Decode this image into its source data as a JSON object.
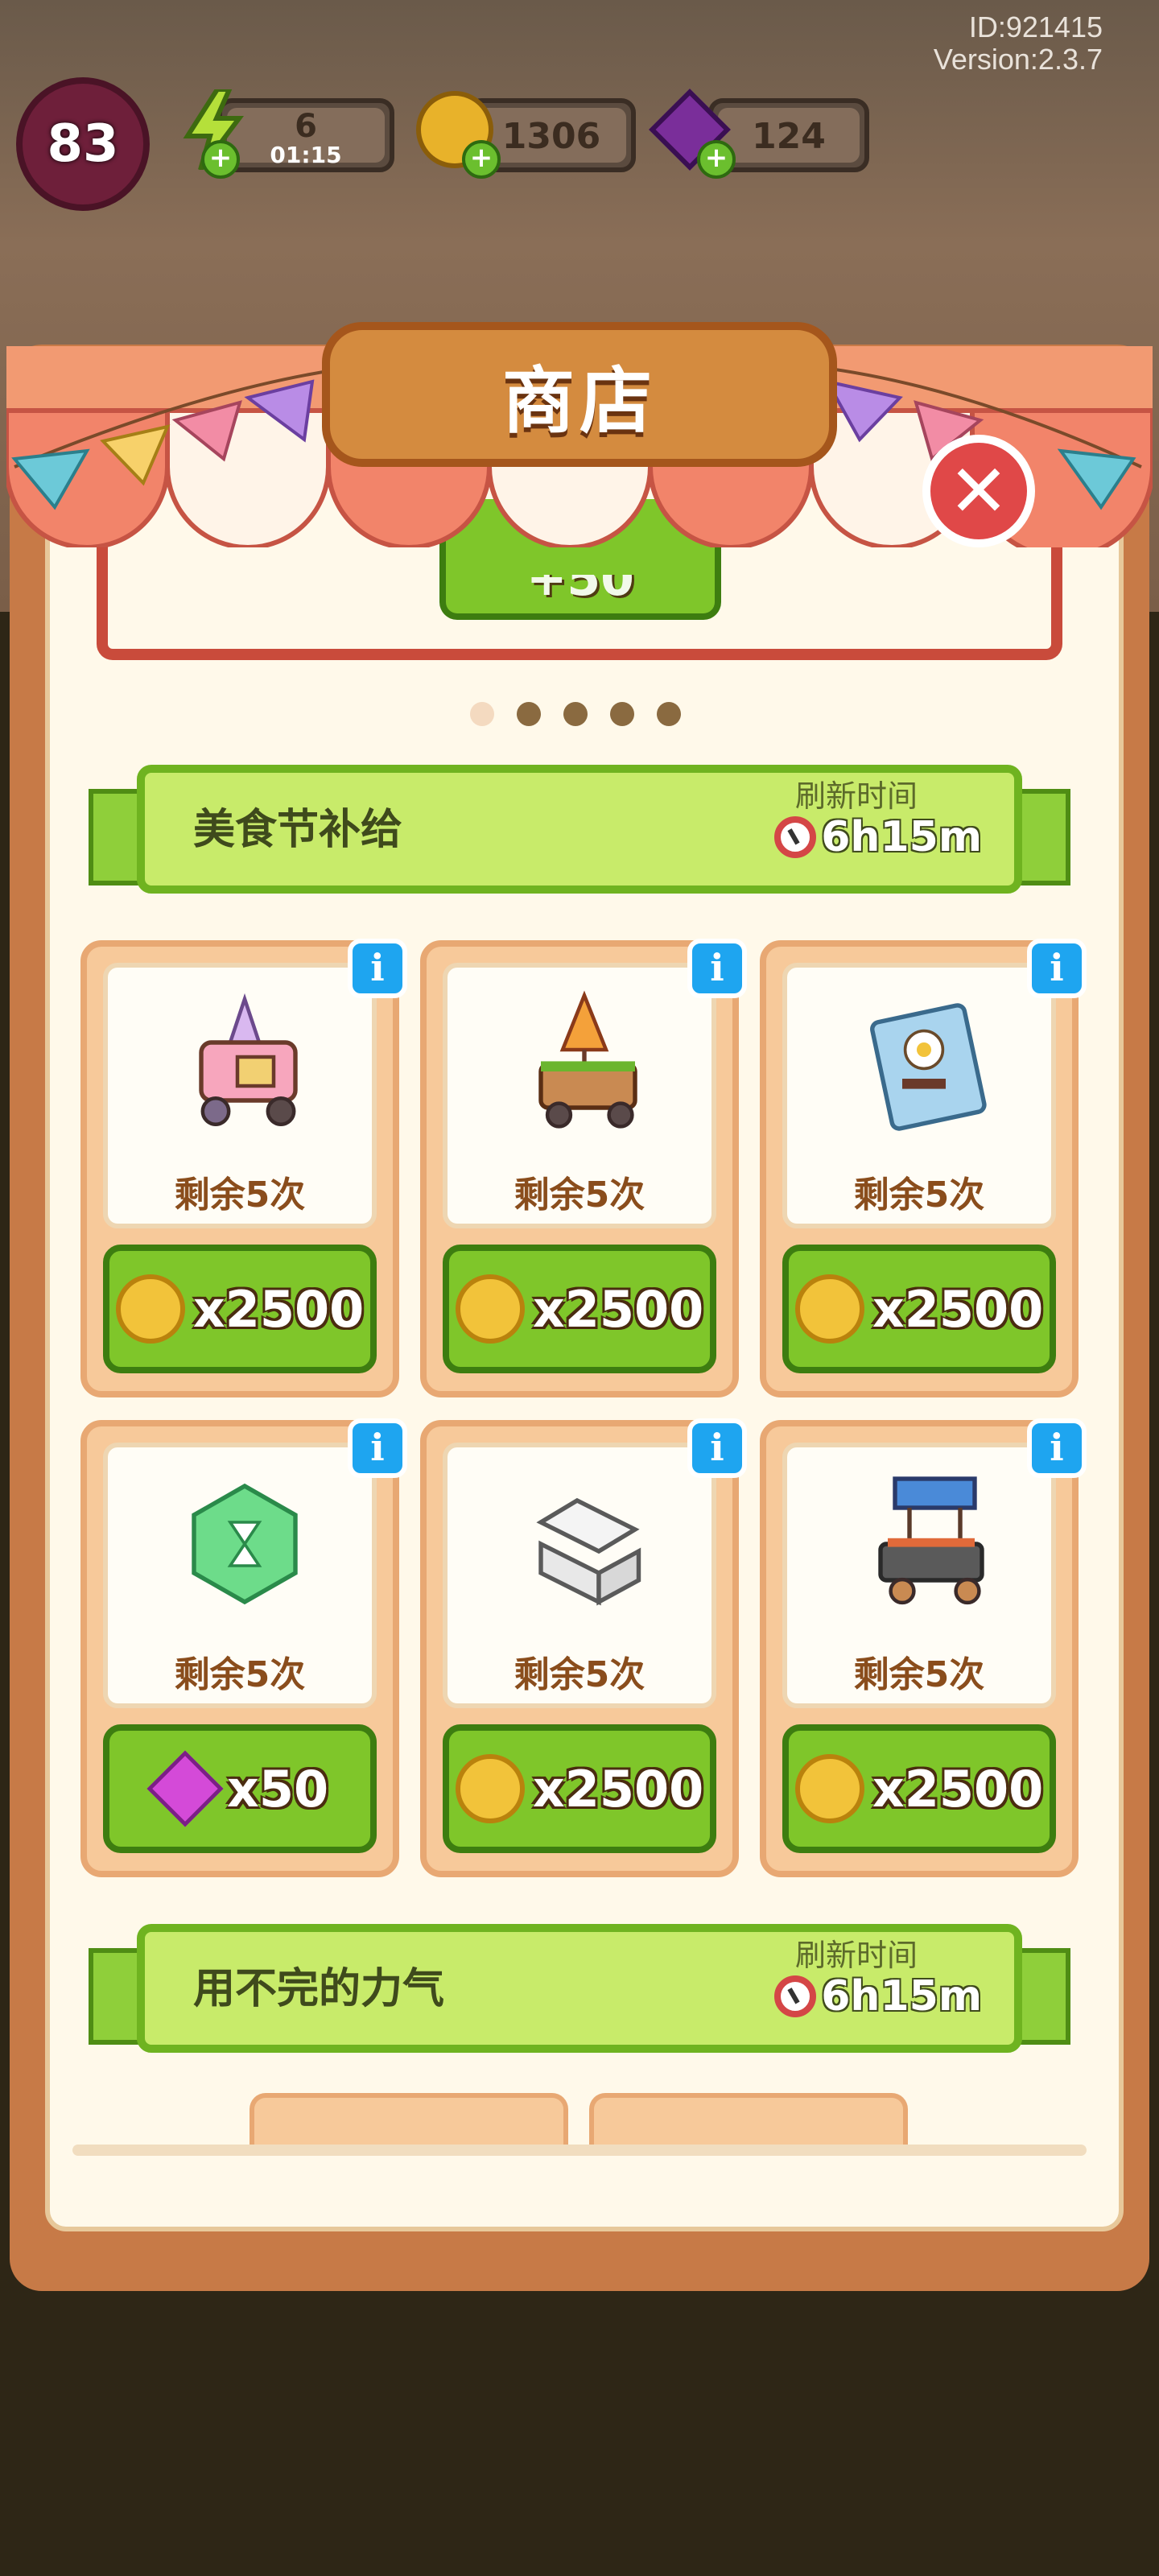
{
  "meta": {
    "id_text": "ID:921415",
    "version_text": "Version:2.3.7"
  },
  "hud": {
    "level": "83",
    "energy": {
      "value": "6",
      "timer": "01:15",
      "icon": "lightning-icon"
    },
    "coins": {
      "value": "1306",
      "icon": "coin-icon"
    },
    "gems": {
      "value": "124",
      "icon": "gem-icon"
    }
  },
  "shop": {
    "title": "商店",
    "banner_button_partial": "+50",
    "carousel": {
      "count": 5,
      "active_index": 0
    },
    "close_icon": "close-icon"
  },
  "sections": [
    {
      "title": "美食节补给",
      "refresh_label": "刷新时间",
      "refresh_time": "6h15m",
      "items": [
        {
          "art": "ice-cream-cart",
          "remaining": "剩余5次",
          "currency": "coin",
          "price": "x2500"
        },
        {
          "art": "drink-cart",
          "remaining": "剩余5次",
          "currency": "coin",
          "price": "x2500"
        },
        {
          "art": "recipe-card",
          "remaining": "剩余5次",
          "currency": "coin",
          "price": "x2500"
        },
        {
          "art": "green-hourglass-gem",
          "remaining": "剩余5次",
          "currency": "gem",
          "price": "x50"
        },
        {
          "art": "takeout-box",
          "remaining": "剩余5次",
          "currency": "coin",
          "price": "x2500"
        },
        {
          "art": "bbq-cart",
          "remaining": "剩余5次",
          "currency": "coin",
          "price": "x2500"
        }
      ]
    },
    {
      "title": "用不完的力气",
      "refresh_label": "刷新时间",
      "refresh_time": "6h15m"
    }
  ],
  "colors": {
    "accent_green": "#7fc62a",
    "panel_brown": "#c77a47",
    "close_red": "#e04848",
    "info_blue": "#1ea5f0"
  }
}
